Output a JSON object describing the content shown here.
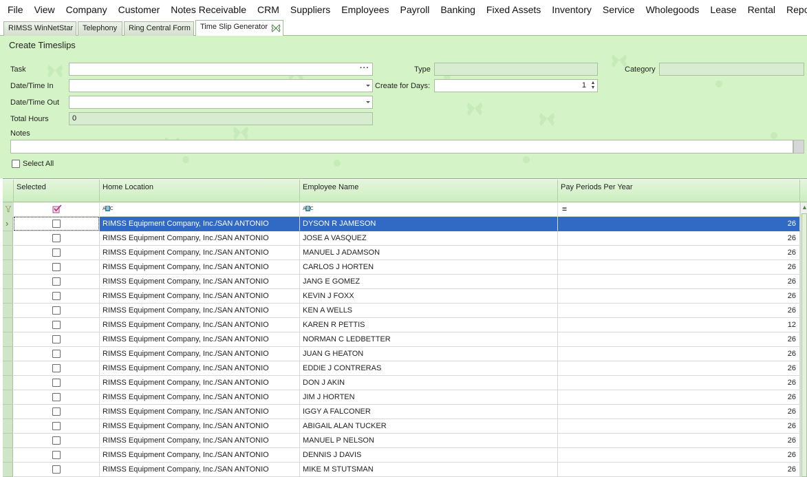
{
  "menu": [
    "File",
    "View",
    "Company",
    "Customer",
    "Notes Receivable",
    "CRM",
    "Suppliers",
    "Employees",
    "Payroll",
    "Banking",
    "Fixed Assets",
    "Inventory",
    "Service",
    "Wholegoods",
    "Lease",
    "Rental",
    "Reports"
  ],
  "tabs": [
    {
      "label": "RIMSS WinNetStar",
      "active": false
    },
    {
      "label": "Telephony",
      "active": false
    },
    {
      "label": "Ring Central Form",
      "active": false
    },
    {
      "label": "Time Slip Generator",
      "active": true
    }
  ],
  "form": {
    "title": "Create Timeslips",
    "task_label": "Task",
    "task_value": "",
    "type_label": "Type",
    "type_value": "",
    "category_label": "Category",
    "category_value": "",
    "datetime_in_label": "Date/Time In",
    "datetime_in_value": "",
    "create_days_label": "Create for Days:",
    "create_days_value": "1",
    "datetime_out_label": "Date/Time Out",
    "datetime_out_value": "",
    "total_hours_label": "Total Hours",
    "total_hours_value": "0",
    "notes_label": "Notes",
    "notes_value": "",
    "select_all_label": "Select All"
  },
  "grid": {
    "columns": [
      "Selected",
      "Home Location",
      "Employee Name",
      "Pay Periods Per Year"
    ],
    "selected_row": 0,
    "rows": [
      {
        "location": "RIMSS Equipment Company, Inc./SAN ANTONIO",
        "name": "DYSON R JAMESON",
        "periods": "26"
      },
      {
        "location": "RIMSS Equipment Company, Inc./SAN ANTONIO",
        "name": "JOSE A VASQUEZ",
        "periods": "26"
      },
      {
        "location": "RIMSS Equipment Company, Inc./SAN ANTONIO",
        "name": "MANUEL J ADAMSON",
        "periods": "26"
      },
      {
        "location": "RIMSS Equipment Company, Inc./SAN ANTONIO",
        "name": "CARLOS J HORTEN",
        "periods": "26"
      },
      {
        "location": "RIMSS Equipment Company, Inc./SAN ANTONIO",
        "name": "JANG E GOMEZ",
        "periods": "26"
      },
      {
        "location": "RIMSS Equipment Company, Inc./SAN ANTONIO",
        "name": "KEVIN J FOXX",
        "periods": "26"
      },
      {
        "location": "RIMSS Equipment Company, Inc./SAN ANTONIO",
        "name": "KEN A WELLS",
        "periods": "26"
      },
      {
        "location": "RIMSS Equipment Company, Inc./SAN ANTONIO",
        "name": "KAREN R PETTIS",
        "periods": "12"
      },
      {
        "location": "RIMSS Equipment Company, Inc./SAN ANTONIO",
        "name": "NORMAN C LEDBETTER",
        "periods": "26"
      },
      {
        "location": "RIMSS Equipment Company, Inc./SAN ANTONIO",
        "name": "JUAN G HEATON",
        "periods": "26"
      },
      {
        "location": "RIMSS Equipment Company, Inc./SAN ANTONIO",
        "name": "EDDIE J CONTRERAS",
        "periods": "26"
      },
      {
        "location": "RIMSS Equipment Company, Inc./SAN ANTONIO",
        "name": "DON J AKIN",
        "periods": "26"
      },
      {
        "location": "RIMSS Equipment Company, Inc./SAN ANTONIO",
        "name": "JIM J HORTEN",
        "periods": "26"
      },
      {
        "location": "RIMSS Equipment Company, Inc./SAN ANTONIO",
        "name": "IGGY A FALCONER",
        "periods": "26"
      },
      {
        "location": "RIMSS Equipment Company, Inc./SAN ANTONIO",
        "name": "ABIGAIL ALAN TUCKER",
        "periods": "26"
      },
      {
        "location": "RIMSS Equipment Company, Inc./SAN ANTONIO",
        "name": "MANUEL P NELSON",
        "periods": "26"
      },
      {
        "location": "RIMSS Equipment Company, Inc./SAN ANTONIO",
        "name": "DENNIS J DAVIS",
        "periods": "26"
      },
      {
        "location": "RIMSS Equipment Company, Inc./SAN ANTONIO",
        "name": "MIKE M STUTSMAN",
        "periods": "26"
      }
    ]
  },
  "icons": {
    "tab_close": "butterfly-close-icon",
    "filter": "filter-icon",
    "selected_filter": "checkmark-icon",
    "text_filter": "abc-icon",
    "equals_filter": "equals-icon"
  },
  "colors": {
    "panel_bg": "#d4f3c7",
    "selection": "#316ac5",
    "header_bg": "#d8f2cc"
  }
}
